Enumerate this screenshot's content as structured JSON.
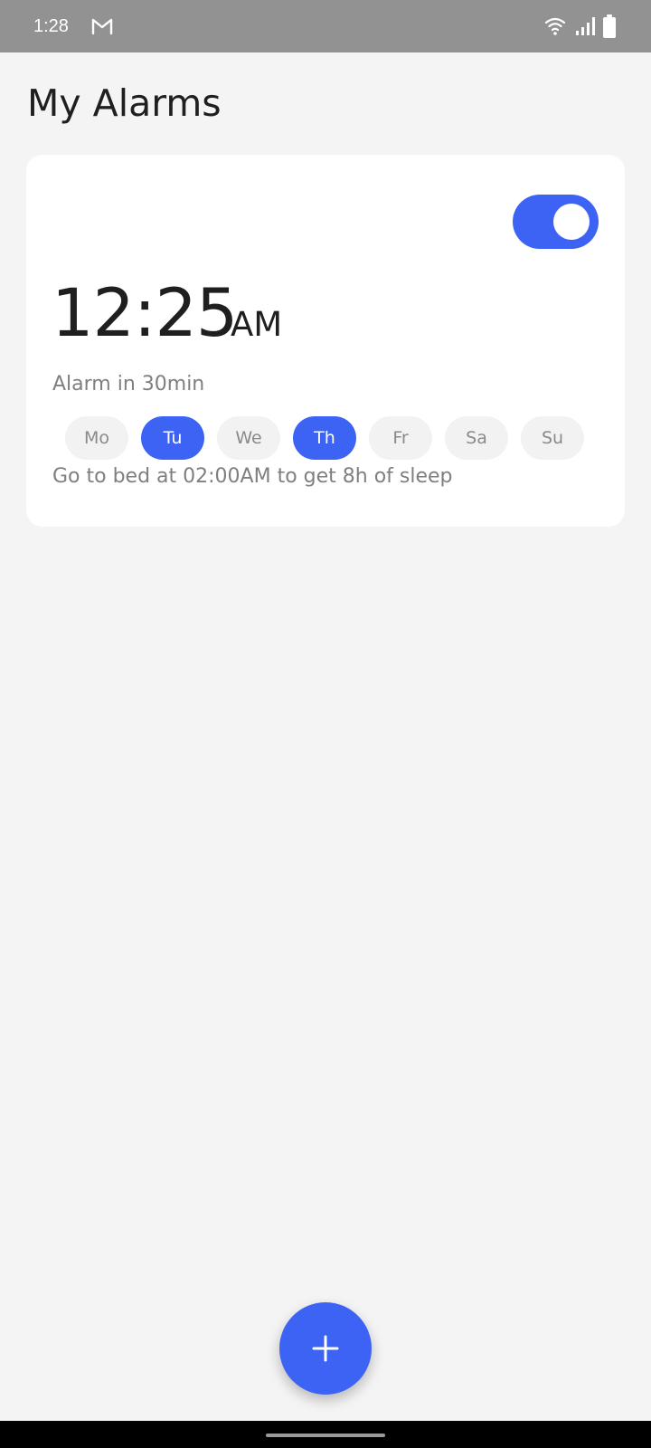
{
  "status_bar": {
    "time": "1:28",
    "icons": [
      "gmail-icon",
      "wifi-icon",
      "signal-icon",
      "battery-icon"
    ]
  },
  "page": {
    "title": "My Alarms"
  },
  "alarm": {
    "enabled": true,
    "time": "12:25",
    "ampm": "AM",
    "countdown": "Alarm in 30min",
    "days": [
      {
        "label": "Mo",
        "selected": false
      },
      {
        "label": "Tu",
        "selected": true
      },
      {
        "label": "We",
        "selected": false
      },
      {
        "label": "Th",
        "selected": true
      },
      {
        "label": "Fr",
        "selected": false
      },
      {
        "label": "Sa",
        "selected": false
      },
      {
        "label": "Su",
        "selected": false
      }
    ],
    "bedtime_text": "Go to bed at 02:00AM to get 8h of sleep"
  },
  "fab": {
    "icon": "plus-icon"
  },
  "colors": {
    "accent": "#3d63f5",
    "background": "#f4f4f4",
    "card": "#ffffff",
    "status_bar": "#929292",
    "muted_text": "#7f7f7f"
  }
}
